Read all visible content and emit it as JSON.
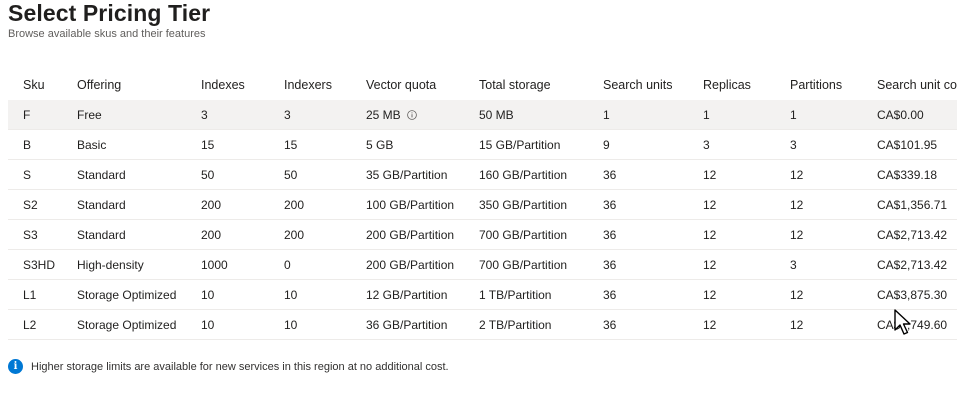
{
  "header": {
    "title": "Select Pricing Tier",
    "subtitle": "Browse available skus and their features"
  },
  "table": {
    "columns": [
      "Sku",
      "Offering",
      "Indexes",
      "Indexers",
      "Vector quota",
      "Total storage",
      "Search units",
      "Replicas",
      "Partitions",
      "Search unit cost"
    ],
    "rows": [
      [
        "F",
        "Free",
        "3",
        "3",
        "25 MB",
        "50 MB",
        "1",
        "1",
        "1",
        "CA$0.00"
      ],
      [
        "B",
        "Basic",
        "15",
        "15",
        "5 GB",
        "15 GB/Partition",
        "9",
        "3",
        "3",
        "CA$101.95"
      ],
      [
        "S",
        "Standard",
        "50",
        "50",
        "35 GB/Partition",
        "160 GB/Partition",
        "36",
        "12",
        "12",
        "CA$339.18"
      ],
      [
        "S2",
        "Standard",
        "200",
        "200",
        "100 GB/Partition",
        "350 GB/Partition",
        "36",
        "12",
        "12",
        "CA$1,356.71"
      ],
      [
        "S3",
        "Standard",
        "200",
        "200",
        "200 GB/Partition",
        "700 GB/Partition",
        "36",
        "12",
        "12",
        "CA$2,713.42"
      ],
      [
        "S3HD",
        "High-density",
        "1000",
        "0",
        "200 GB/Partition",
        "700 GB/Partition",
        "36",
        "12",
        "3",
        "CA$2,713.42"
      ],
      [
        "L1",
        "Storage Optimized",
        "10",
        "10",
        "12 GB/Partition",
        "1 TB/Partition",
        "36",
        "12",
        "12",
        "CA$3,875.30"
      ],
      [
        "L2",
        "Storage Optimized",
        "10",
        "10",
        "36 GB/Partition",
        "2 TB/Partition",
        "36",
        "12",
        "12",
        "CA$7,749.60"
      ]
    ],
    "selected_row": 0
  },
  "info": {
    "icon": "info-icon",
    "text": "Higher storage limits are available for new services in this region at no additional cost."
  },
  "colors": {
    "selected_row_bg": "#f3f2f1",
    "info_blue": "#0078d4",
    "row_divider": "#edebe9"
  }
}
